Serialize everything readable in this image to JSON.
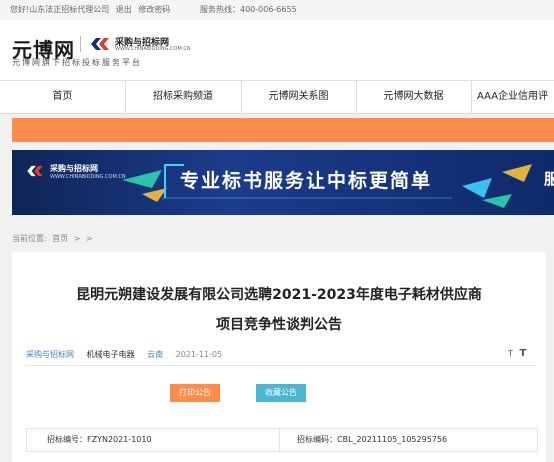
{
  "topbar": {
    "greeting": "您好!山东法正招标代理公司",
    "logout": "退出",
    "change_password": "修改密码",
    "hotline": "服务热线：400-006-6655"
  },
  "header": {
    "logo_text": "元博网",
    "sub_logo_cn": "采购与招标网",
    "sub_logo_en": "WWW.CHINABIDDING.COM.CN",
    "slogan": "元博网旗下招标投标服务平台"
  },
  "nav": {
    "items": [
      "首页",
      "招标采购频道",
      "元博网关系图",
      "元博网大数据",
      "AAA企业信用评"
    ]
  },
  "banner": {
    "logo_cn": "采购与招标网",
    "logo_en": "WWW.CHINABIDDING.COM.CN",
    "slogan": "专业标书服务让中标更简单",
    "cut_text": "服"
  },
  "breadcrumb": {
    "prefix": "当前位置:",
    "home": "首页",
    "sep1": ">",
    "sep2": ">"
  },
  "article": {
    "title_line1": "昆明元朔建设发展有限公司选聘2021-2023年度电子耗材供应商",
    "title_line2": "项目竞争性谈判公告",
    "source": "采购与招标网",
    "category": "机械电子电器",
    "region": "云南",
    "date": "2021-11-05",
    "font_small": "T",
    "font_large": "T",
    "print_label": "打印公告",
    "favorite_label": "收藏公告",
    "tender_no": "招标编号：FZYN2021-1010",
    "tender_code": "招标编码：CBL_20211105_105295756"
  },
  "colors": {
    "accent_orange": "#ff8c4c",
    "accent_teal": "#4cb6d0",
    "banner_blue": "#1c3c8c"
  }
}
